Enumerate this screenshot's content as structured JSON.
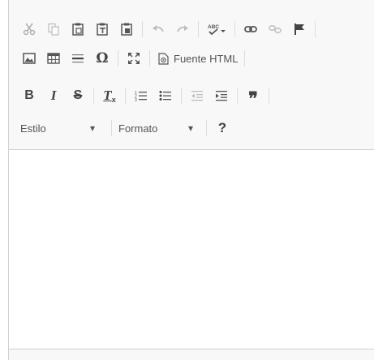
{
  "toolbar": {
    "row1": {
      "cut": "cut-icon",
      "copy": "copy-icon",
      "paste": "paste-icon",
      "paste_text": "paste-text-icon",
      "paste_word": "paste-from-word-icon",
      "undo": "undo-icon",
      "redo": "redo-icon",
      "spellcheck": "spellcheck-icon",
      "link": "link-icon",
      "unlink": "unlink-icon",
      "anchor": "anchor-flag-icon"
    },
    "row2": {
      "image": "image-icon",
      "table": "table-icon",
      "hr": "horizontal-line-icon",
      "special_char_label": "Ω",
      "maximize": "maximize-icon",
      "source_label": "Fuente HTML"
    },
    "row3": {
      "bold_label": "B",
      "italic_label": "I",
      "strike_label": "S",
      "remove_format_label": "T",
      "remove_format_sub": "x",
      "numbered_list": "numbered-list-icon",
      "bulleted_list": "bulleted-list-icon",
      "outdent": "outdent-icon",
      "indent": "indent-icon",
      "blockquote_label": "❞"
    },
    "row4": {
      "style_label": "Estilo",
      "format_label": "Formato",
      "help_label": "?"
    }
  },
  "colors": {
    "toolbar_bg": "#f8f8f8",
    "border": "#d1d1d1",
    "icon": "#444444",
    "disabled_icon": "#9a9a9a"
  }
}
